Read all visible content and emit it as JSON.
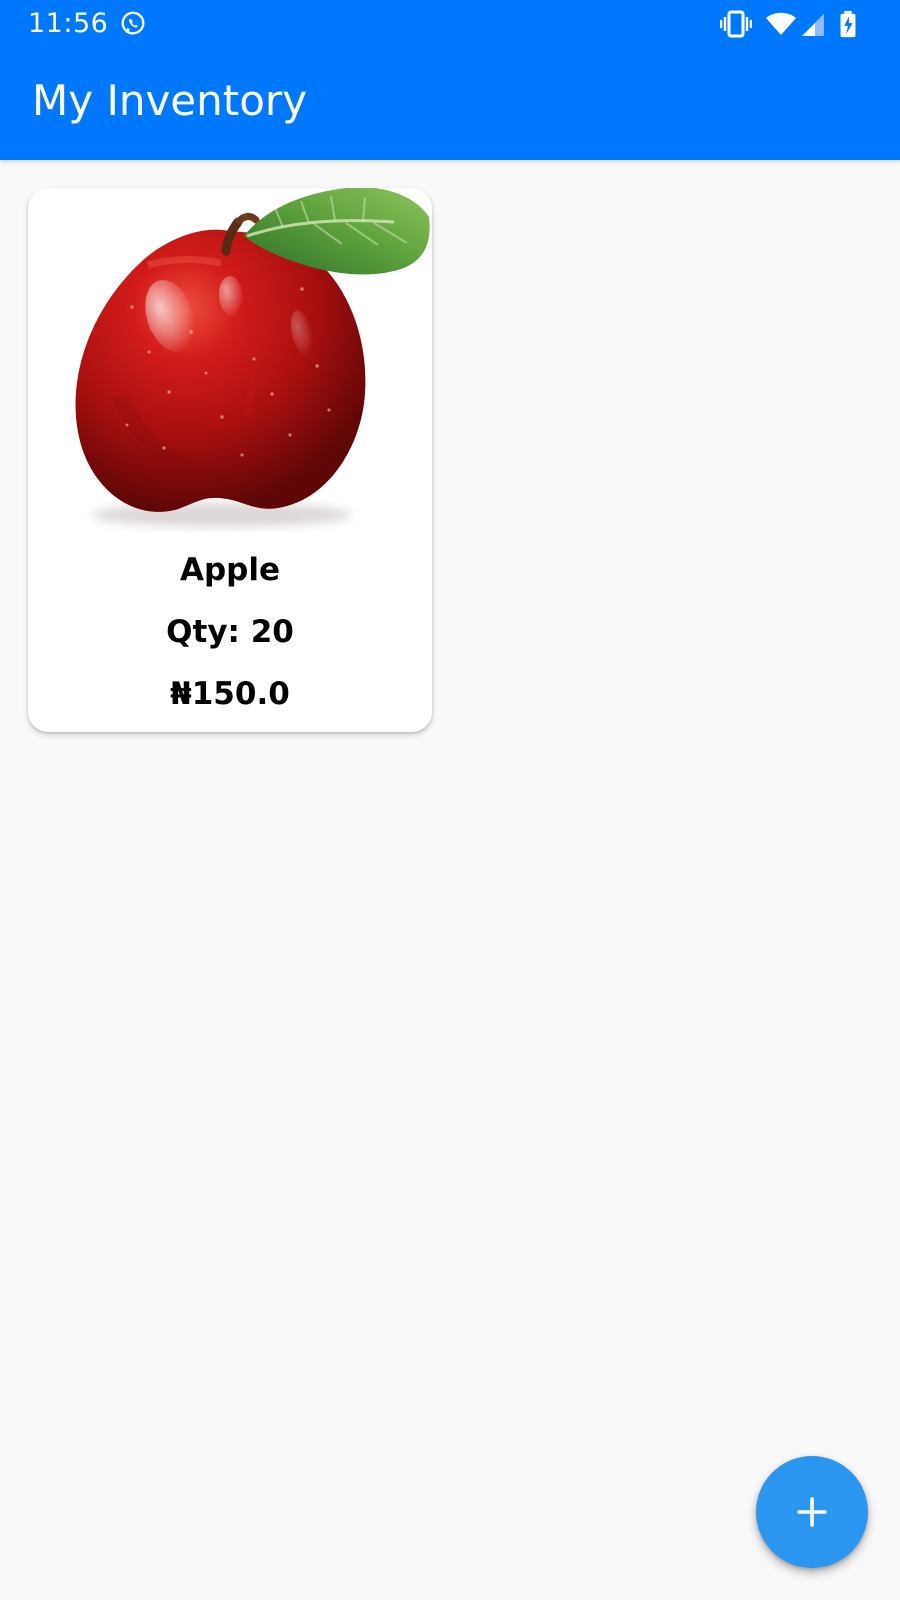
{
  "status_bar": {
    "time": "11:56",
    "icons": [
      "whatsapp-icon",
      "vibrate-icon",
      "wifi-icon",
      "signal-icon",
      "battery-charging-icon"
    ]
  },
  "app_bar": {
    "title": "My Inventory",
    "color": "#0078fe"
  },
  "inventory": {
    "items": [
      {
        "image": "apple-image",
        "name": "Apple",
        "qty": "Qty: 20",
        "price": "₦150.0"
      }
    ]
  },
  "fab": {
    "icon": "plus-icon",
    "color": "#2b96f0"
  }
}
